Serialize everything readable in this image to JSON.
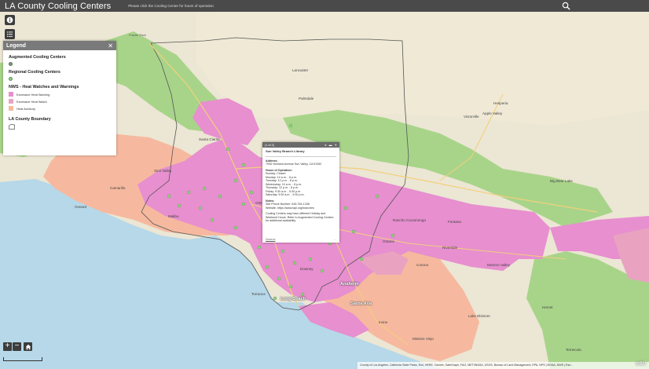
{
  "header": {
    "title": "LA County Cooling Centers",
    "subtitle": "Please click the Cooling Center for hours of operation"
  },
  "legend": {
    "title": "Legend",
    "sections": [
      {
        "title": "Augmented Cooling Centers",
        "items": [
          {
            "label": "",
            "shape": "dot",
            "color": "#7d9e7b"
          }
        ]
      },
      {
        "title": "Regional Cooling Centers",
        "items": [
          {
            "label": "",
            "shape": "dot",
            "color": "#8fd47e"
          }
        ]
      },
      {
        "title": "NWS - Heat Watches and Warnings",
        "items": [
          {
            "label": "Excessive Heat Warning",
            "shape": "swatch",
            "color": "#e78fcf"
          },
          {
            "label": "Excessive Heat Watch",
            "shape": "swatch",
            "color": "#e9a3c0"
          },
          {
            "label": "Heat Advisory",
            "shape": "swatch",
            "color": "#f6b99f"
          }
        ]
      },
      {
        "title": "LA County Boundary",
        "items": [
          {
            "label": "",
            "shape": "outline",
            "color": "#555555"
          }
        ]
      }
    ]
  },
  "popup": {
    "counter": "(1 of 2)",
    "title": "Sun Valley Branch Library",
    "address_label": "Address:",
    "address": "7935 Vineland Avenue Sun Valley, CA 91352",
    "hours_label": "Hours of Operation:",
    "hours": [
      "Sunday: Closed",
      "Monday: 10 a.m. - 8 p.m.",
      "Tuesday: 12 p.m. - 8 p.m.",
      "Wednesday: 10 a.m. - 8 p.m.",
      "Thursday: 12 p.m. - 8 p.m.",
      "Friday: 9:30 a.m. - 5:30 p.m.",
      "Saturday: 9:30 a.m. - 5:30 p.m."
    ],
    "notes_label": "Notes:",
    "notes": [
      "Site Phone Number: 818-764-1338",
      "Website: https://www.lapl.org/branches"
    ],
    "disclaimer": "Cooling Centers may have different Holiday and Weekend Hours. Refer to Augmented Cooling Centers for additional availability.",
    "zoom_link": "Zoom to",
    "more": "..."
  },
  "zoom": {
    "in": "+",
    "out": "−"
  },
  "attribution": "County of Los Angeles, California State Parks, Esri, HERE, Garmin, SafeGraph, FAO, METI/NASA, USGS, Bureau of Land Management, EPA, NPS | NOAA, NWS | Esri...",
  "esri_logo": "esri",
  "places": [
    {
      "name": "Frazier Park"
    },
    {
      "name": "Lancaster"
    },
    {
      "name": "Palmdale"
    },
    {
      "name": "Hesperia"
    },
    {
      "name": "Victorville"
    },
    {
      "name": "Apple Valley"
    },
    {
      "name": "Santa Clarita"
    },
    {
      "name": "Simi Valley"
    },
    {
      "name": "Camarillo"
    },
    {
      "name": "Oxnard"
    },
    {
      "name": "Malibu"
    },
    {
      "name": "Glendale"
    },
    {
      "name": "Pasadena"
    },
    {
      "name": "Anaheim"
    },
    {
      "name": "Santa Ana"
    },
    {
      "name": "Long Beach"
    },
    {
      "name": "Riverside"
    },
    {
      "name": "Moreno Valley"
    },
    {
      "name": "Rancho Cucamonga"
    },
    {
      "name": "Fontana"
    },
    {
      "name": "Corona"
    },
    {
      "name": "Irvine"
    },
    {
      "name": "Hemet"
    },
    {
      "name": "Temecula"
    },
    {
      "name": "Mission Viejo"
    },
    {
      "name": "Big Bear Lake"
    },
    {
      "name": "Lake Elsinore"
    },
    {
      "name": "Ontario"
    },
    {
      "name": "Torrance"
    },
    {
      "name": "Downey"
    }
  ],
  "colors": {
    "header": "#4a4a4a",
    "warning": "#e78fcf",
    "watch": "#e9a3c0",
    "advisory": "#f6b99f",
    "forest": "#a8d48a",
    "land": "#ece6d4",
    "water": "#b6d8e8"
  }
}
